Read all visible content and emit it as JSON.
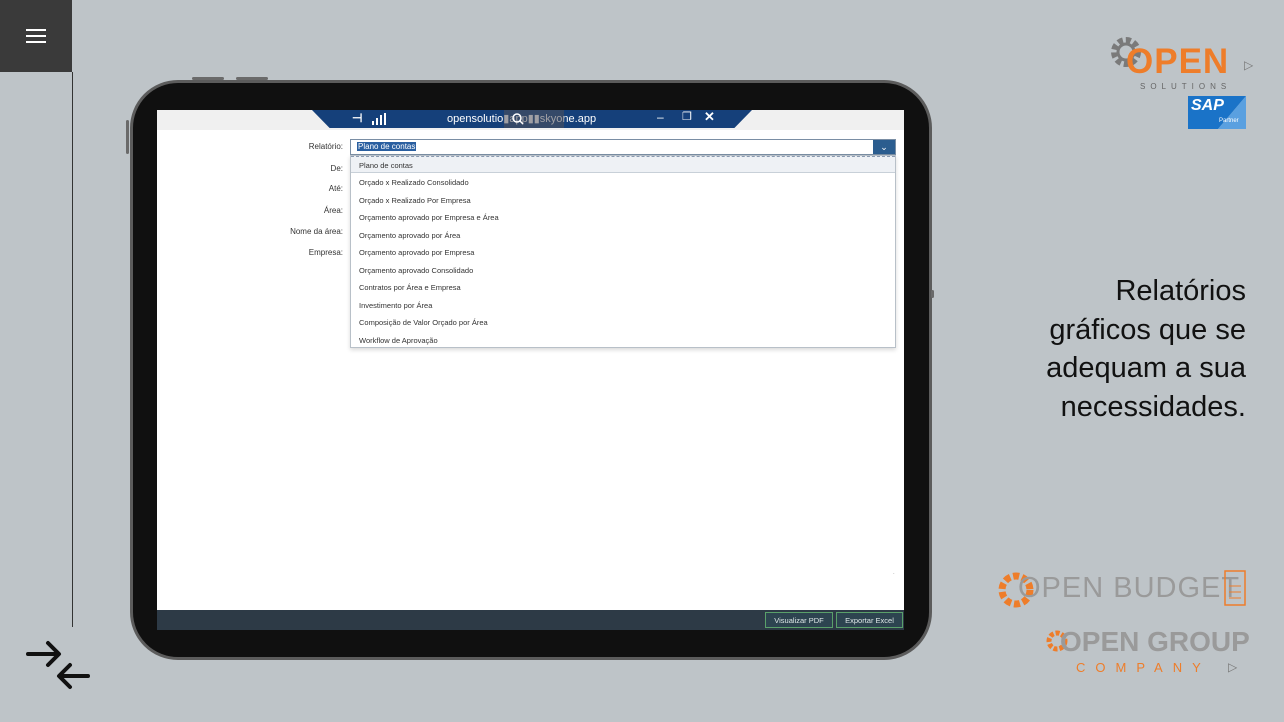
{
  "sidebar": {
    "menu_icon": "hamburger-menu-icon",
    "collapse_icon": "arrows-collapse-icon"
  },
  "window": {
    "title": "opensolutionapp-dev.skyone.app",
    "title_visible": "opensolutio",
    "title_visible_end": "skyone.app",
    "pin_icon": "pin-icon",
    "signal_icon": "signal-icon",
    "zoom_icon": "zoom-icon",
    "min_label": "–",
    "restore_label": "❐",
    "close_label": "✕"
  },
  "form": {
    "labels": {
      "relatorio": "Relatório:",
      "de": "De:",
      "ate": "Até:",
      "area": "Área:",
      "nome_area": "Nome da área:",
      "empresa": "Empresa:"
    },
    "relatorio_value": "Plano de contas",
    "dropdown_arrow": "⌄"
  },
  "dropdown": {
    "options": [
      "Plano de contas",
      "Orçado x Realizado Consolidado",
      "Orçado x Realizado Por Empresa",
      "Orçamento aprovado por Empresa e Área",
      "Orçamento aprovado por Área",
      "Orçamento aprovado por Empresa",
      "Orçamento aprovado Consolidado",
      "Contratos por Área e Empresa",
      "Investimento por Área",
      "Composição de Valor Orçado por Área",
      "Workflow de Aprovação"
    ],
    "selected_index": 0
  },
  "footer": {
    "pdf_button": "Visualizar PDF",
    "excel_button": "Exportar Excel"
  },
  "branding": {
    "open_logo": "OPEN",
    "open_sub": "SOLUTIONS",
    "sap": "SAP",
    "sap_partner": "Partner",
    "budget": "OPEN BUDGET",
    "group": "OPEN GROUP",
    "company": "COMPANY",
    "accent_color": "#ee7d2a",
    "sap_color": "#1a73c8"
  },
  "tagline": [
    "Relatórios",
    "gráficos que se",
    "adequam a sua",
    "necessidades."
  ]
}
